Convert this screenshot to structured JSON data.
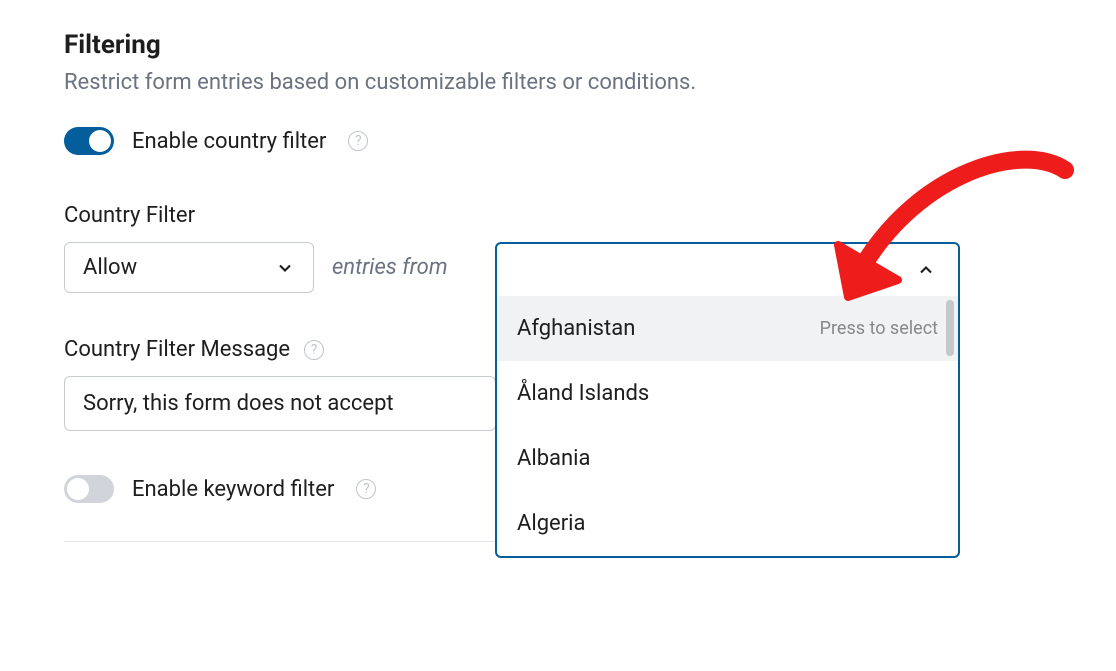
{
  "section": {
    "title": "Filtering",
    "description": "Restrict form entries based on customizable filters or conditions."
  },
  "country_filter_toggle": {
    "label": "Enable country filter",
    "enabled": true
  },
  "country_filter": {
    "label": "Country Filter",
    "mode": "Allow",
    "entries_text": "entries from",
    "dropdown_hint": "Press to select",
    "countries": [
      "Afghanistan",
      "Åland Islands",
      "Albania",
      "Algeria"
    ]
  },
  "country_filter_message": {
    "label": "Country Filter Message",
    "value": "Sorry, this form does not accept"
  },
  "keyword_filter_toggle": {
    "label": "Enable keyword filter",
    "enabled": false
  }
}
